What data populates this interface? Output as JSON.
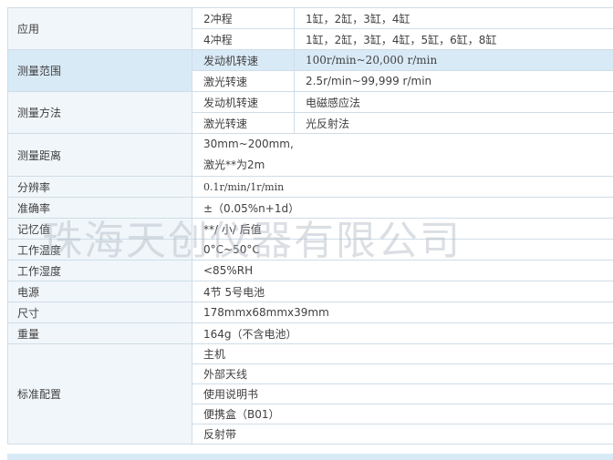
{
  "watermark": "珠海天创仪器有限公司",
  "rows": {
    "app_label": "应用",
    "app_2": {
      "label": "2冲程",
      "value": "1缸，2缸，3缸，4缸"
    },
    "app_4": {
      "label": "4冲程",
      "value": "1缸，2缸，3缸，4缸，5缸，6缸，8缸"
    },
    "range_label": "测量范围",
    "range_engine": {
      "label": "发动机转速",
      "value": "100r/min~20,000 r/min"
    },
    "range_laser": {
      "label": "激光转速",
      "value": "2.5r/min~99,999 r/min"
    },
    "method_label": "测量方法",
    "method_engine": {
      "label": "发动机转速",
      "value": "电磁感应法"
    },
    "method_laser": {
      "label": "激光转速",
      "value": "光反射法"
    },
    "distance_label": "测量距离",
    "distance_line1": "30mm~200mm,",
    "distance_line2": "激光**为2m",
    "resolution": {
      "label": "分辨率",
      "value": "0.1r/min/1r/min"
    },
    "accuracy": {
      "label": "准确率",
      "value": "±（0.05%n+1d）"
    },
    "memory": {
      "label": "记忆值",
      "value": "**/  小/  后值"
    },
    "work_temp": {
      "label": "工作温度",
      "value": "0°C~50°C"
    },
    "work_humidity": {
      "label": "工作湿度",
      "value": "<85%RH"
    },
    "power": {
      "label": "电源",
      "value": "4节 5号电池"
    },
    "size": {
      "label": "尺寸",
      "value": "178mmx68mmx39mm"
    },
    "weight": {
      "label": "重量",
      "value": "164g（不含电池）"
    },
    "config_label": "标准配置",
    "config_items": [
      "主机",
      "外部天线",
      "使用说明书",
      "便携盒（B01）",
      "反射带"
    ]
  }
}
